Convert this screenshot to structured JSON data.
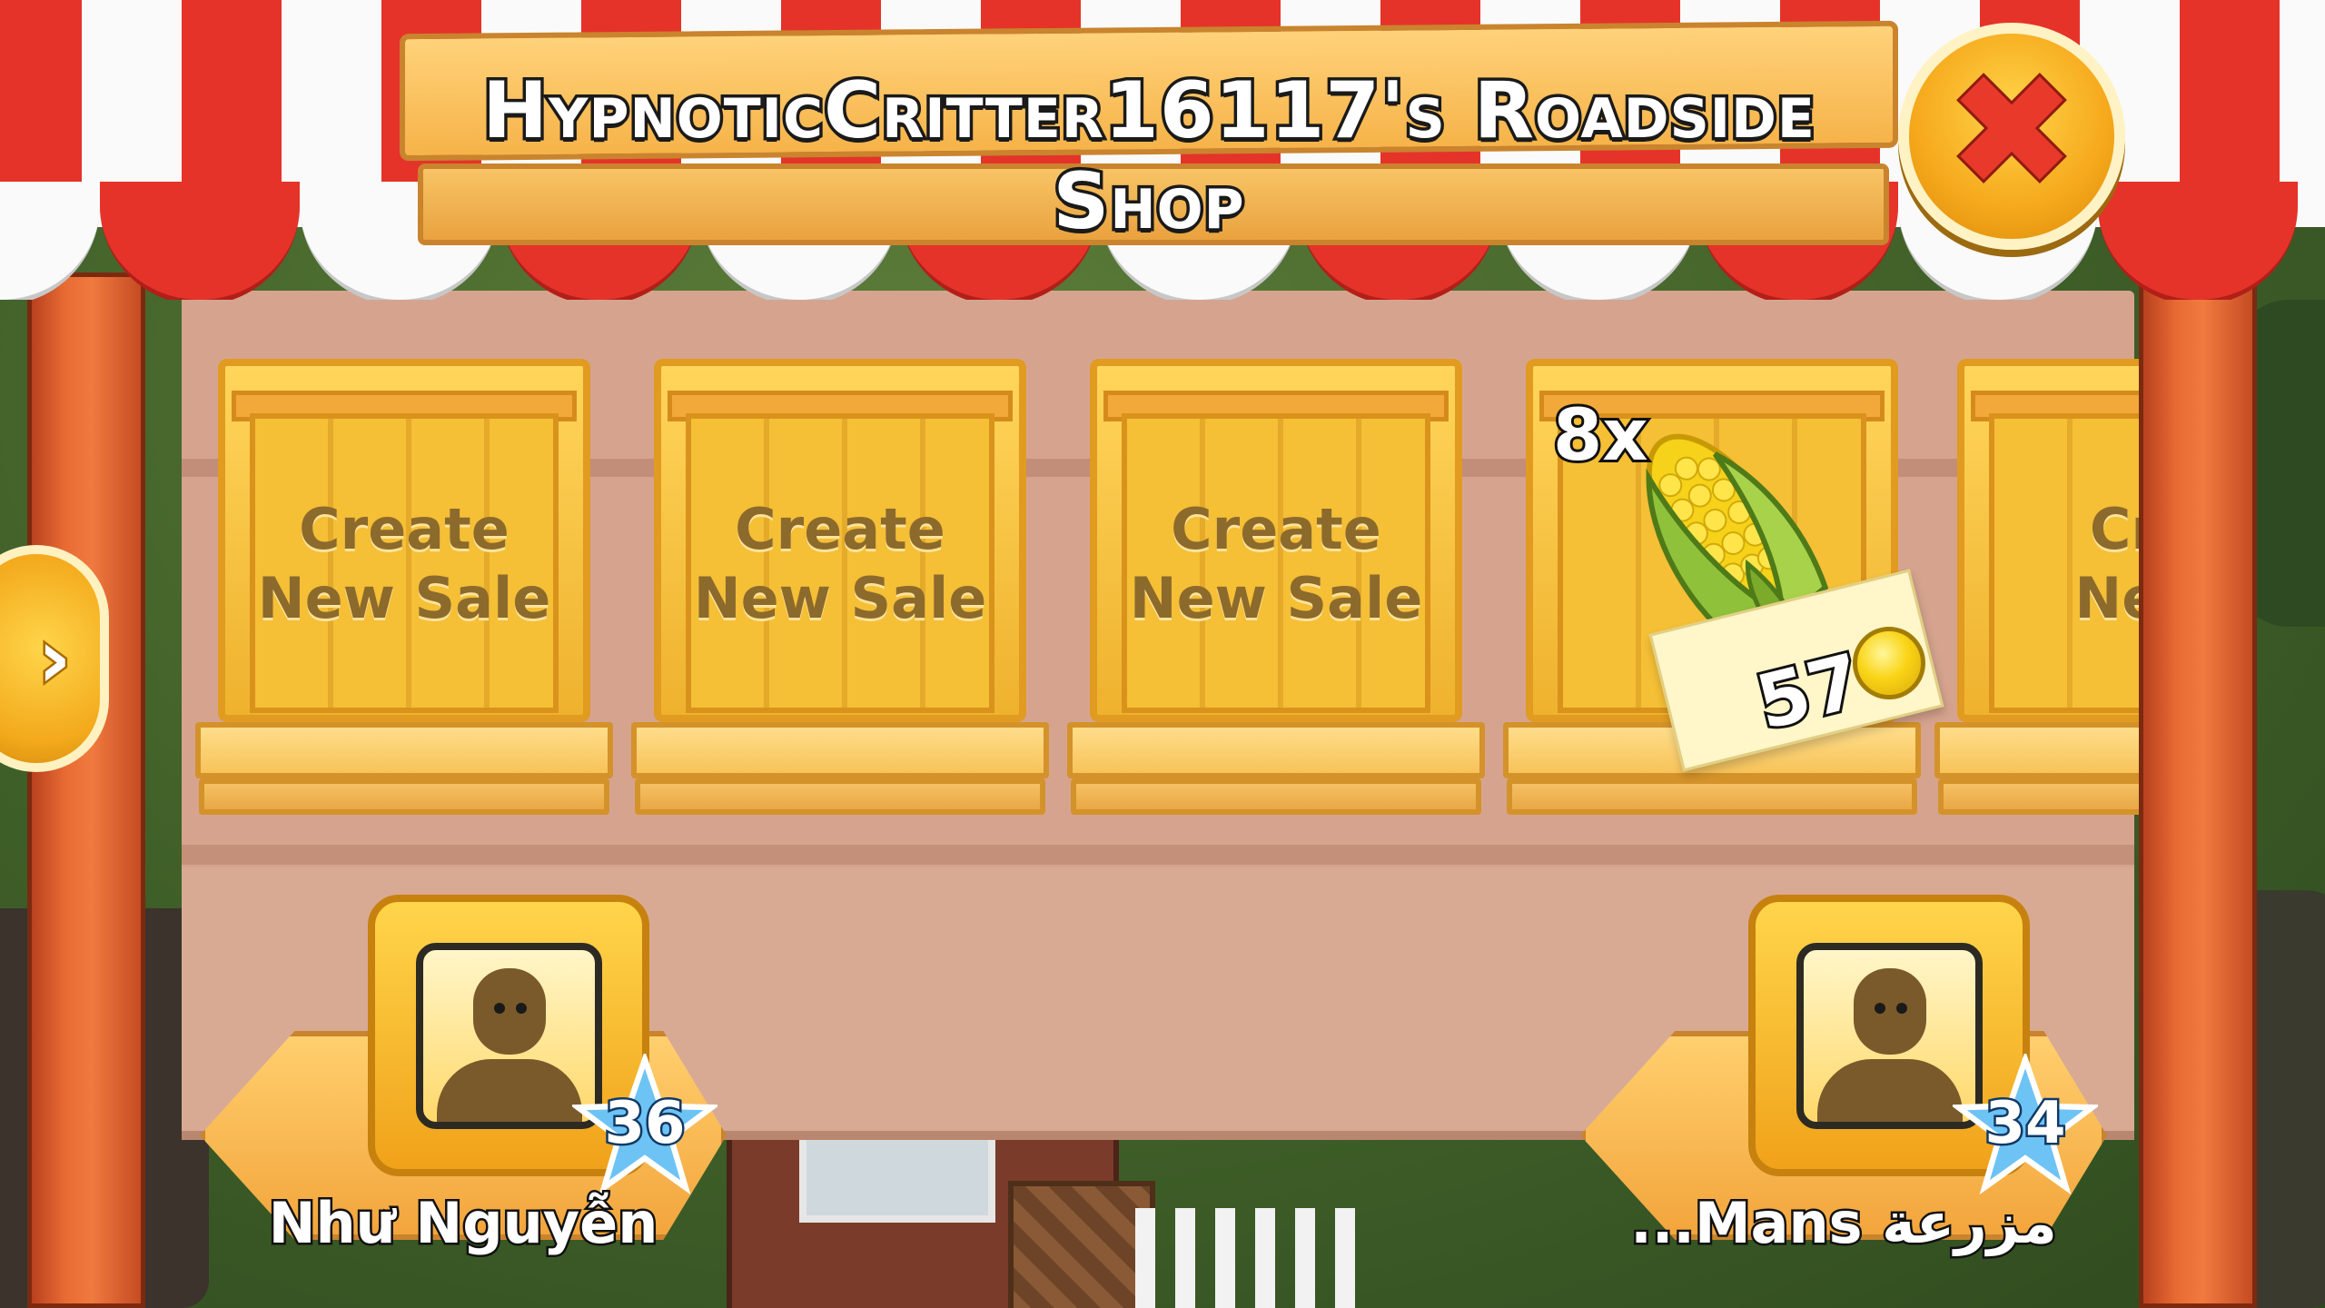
{
  "shop": {
    "title": "HypnoticCritter16117's Roadside Shop"
  },
  "close": {
    "icon": "close-icon",
    "glyph": "✖"
  },
  "nav": {
    "left_icon": "chevron-right-icon",
    "glyph": "›"
  },
  "slots": [
    {
      "label_line1": "Create",
      "label_line2": "New Sale"
    },
    {
      "label_line1": "Create",
      "label_line2": "New Sale"
    },
    {
      "label_line1": "Create",
      "label_line2": "New Sale"
    },
    {
      "item": "corn",
      "qty": "8x",
      "price": "57",
      "price_icon": "coin-icon"
    },
    {
      "label_line1": "Cre",
      "label_line2": "New"
    }
  ],
  "neighbors": [
    {
      "name": "Như Nguyễn",
      "level": "36"
    },
    {
      "name": "...Mans مزرعة",
      "level": "34"
    }
  ],
  "colors": {
    "awning_red": "#e5332a",
    "awning_white": "#fafafa",
    "crate_yellow": "#f5bf36",
    "board": "#d6a48e",
    "post": "#e86a33",
    "close_x": "#e8392a"
  }
}
